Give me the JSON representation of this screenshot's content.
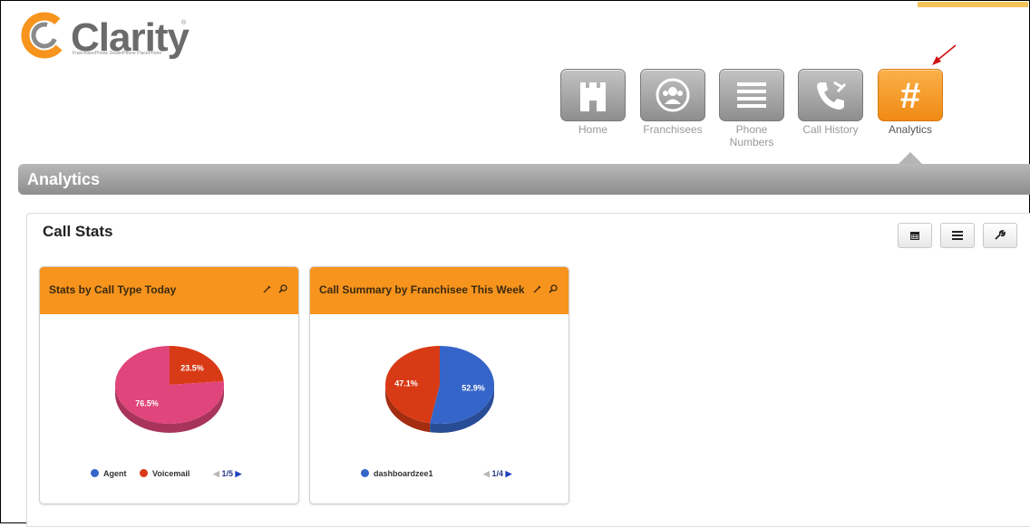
{
  "app": {
    "logo_text": "Clarity",
    "logo_tagline": "FranchiseePhone  DealerPhone  PlacePhone"
  },
  "nav": [
    {
      "label": "Home",
      "icon": "home-icon",
      "active": false
    },
    {
      "label": "Franchisees",
      "icon": "franchisees-icon",
      "active": false
    },
    {
      "label": "Phone Numbers",
      "icon": "phone-numbers-icon",
      "active": false
    },
    {
      "label": "Call History",
      "icon": "call-history-icon",
      "active": false
    },
    {
      "label": "Analytics",
      "icon": "hash-icon",
      "active": true
    }
  ],
  "section": {
    "title": "Analytics"
  },
  "panel": {
    "title": "Call Stats",
    "tools": [
      "calendar-icon",
      "list-icon",
      "wrench-icon"
    ]
  },
  "colors": {
    "accent_orange": "#f7941d",
    "pink": "#e0457b",
    "red": "#d93a16",
    "blue": "#3565c8"
  },
  "widgets": [
    {
      "title": "Stats by Call Type Today",
      "legend": [
        {
          "label": "Agent",
          "color": "#3565c8"
        },
        {
          "label": "Voicemail",
          "color": "#d93a16"
        }
      ],
      "pager": "1/5"
    },
    {
      "title": "Call Summary by Franchisee This Week",
      "legend": [
        {
          "label": "dashboardzee1",
          "color": "#3565c8"
        }
      ],
      "pager": "1/4"
    }
  ],
  "chart_data": [
    {
      "type": "pie",
      "title": "Stats by Call Type Today",
      "slices": [
        {
          "value": 23.5,
          "label": "23.5%",
          "color": "#d93a16"
        },
        {
          "value": 76.5,
          "label": "76.5%",
          "color": "#e0457b"
        }
      ]
    },
    {
      "type": "pie",
      "title": "Call Summary by Franchisee This Week",
      "slices": [
        {
          "value": 52.9,
          "label": "52.9%",
          "color": "#3565c8"
        },
        {
          "value": 47.1,
          "label": "47.1%",
          "color": "#d93a16"
        }
      ]
    }
  ]
}
